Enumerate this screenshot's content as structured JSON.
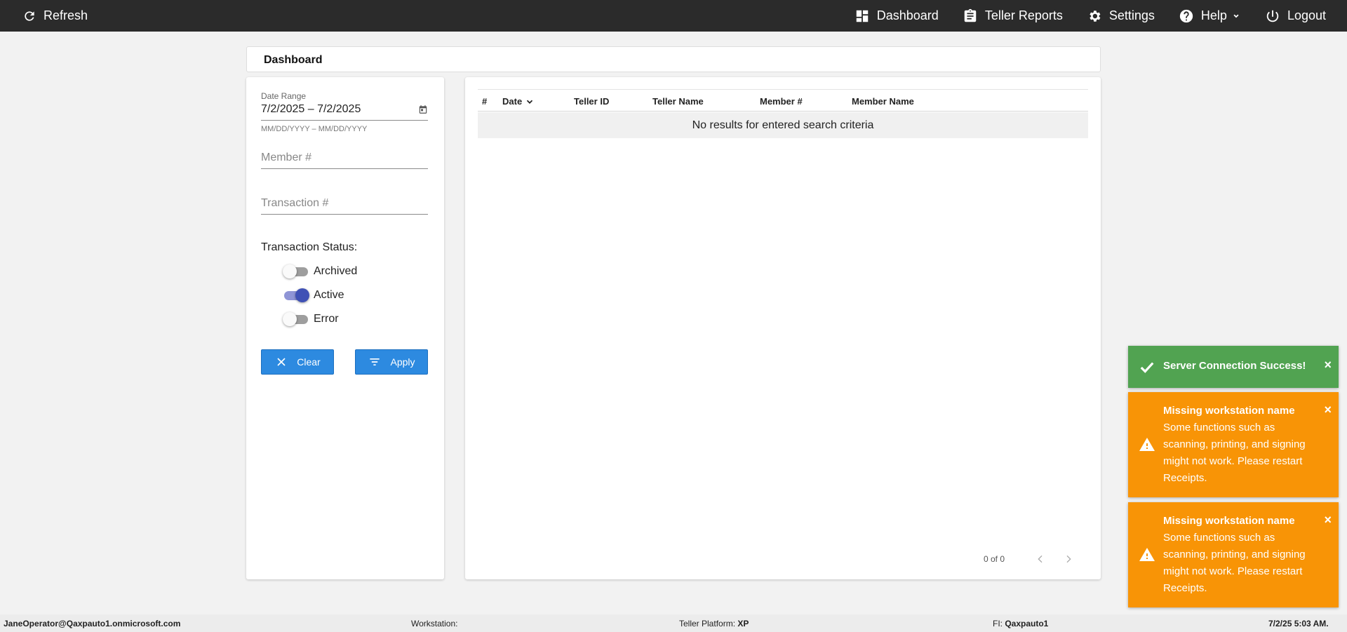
{
  "nav": {
    "refresh": "Refresh",
    "dashboard": "Dashboard",
    "teller_reports": "Teller Reports",
    "settings": "Settings",
    "help": "Help",
    "logout": "Logout"
  },
  "page": {
    "title": "Dashboard"
  },
  "filters": {
    "date_range_label": "Date Range",
    "date_range_value": "7/2/2025 – 7/2/2025",
    "date_range_hint": "MM/DD/YYYY – MM/DD/YYYY",
    "member_placeholder": "Member #",
    "transaction_placeholder": "Transaction #",
    "status_title": "Transaction Status:",
    "statuses": [
      {
        "label": "Archived",
        "on": false
      },
      {
        "label": "Active",
        "on": true
      },
      {
        "label": "Error",
        "on": false
      }
    ],
    "clear_label": "Clear",
    "apply_label": "Apply"
  },
  "table": {
    "columns": [
      "#",
      "Date",
      "Teller ID",
      "Teller Name",
      "Member #",
      "Member Name"
    ],
    "empty_message": "No results for entered search criteria",
    "pager": "0 of 0"
  },
  "toasts": [
    {
      "type": "success",
      "title": "Server Connection Success!",
      "message": ""
    },
    {
      "type": "warning",
      "title": "Missing workstation name",
      "message": "Some functions such as scanning, printing, and signing might not work. Please restart Receipts."
    },
    {
      "type": "warning",
      "title": "Missing workstation name",
      "message": "Some functions such as scanning, printing, and signing might not work. Please restart Receipts."
    }
  ],
  "footer": {
    "user": "JaneOperator@Qaxpauto1.onmicrosoft.com",
    "workstation_label": "Workstation:",
    "workstation_value": "",
    "platform_label": "Teller Platform:",
    "platform_value": "XP",
    "fi_label": "FI:",
    "fi_value": "Qaxpauto1",
    "datetime": "7/2/25 5:03 AM."
  },
  "colors": {
    "topbar": "#2b2b2b",
    "button": "#2d8ae0",
    "toggle_on": "#3f51b5",
    "toast_success": "#51a351",
    "toast_warning": "#f89406"
  }
}
